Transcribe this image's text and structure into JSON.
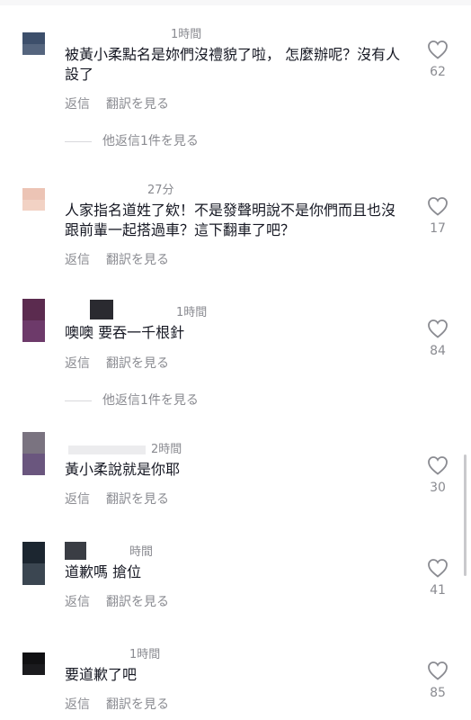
{
  "comments": [
    {
      "time": "1時間",
      "text": "被黃小柔點名是妳們沒禮貌了啦， 怎麼辦呢？沒有人設了",
      "reply": "返信",
      "translate": "翻訳を見る",
      "likes": "62",
      "more_replies": "他返信1件を見る",
      "avatar_colors": [
        "#3d4f6b",
        "#55657e"
      ]
    },
    {
      "time": "27分",
      "text": "人家指名道姓了欸！不是發聲明說不是你們而且也沒跟前輩一起搭過車？這下翻車了吧？",
      "reply": "返信",
      "translate": "翻訳を見る",
      "likes": "17",
      "avatar_colors": [
        "#ecc4b5",
        "#f2d2c4"
      ]
    },
    {
      "time": "1時間",
      "text": "噢噢 要吞一千根針",
      "reply": "返信",
      "translate": "翻訳を見る",
      "likes": "84",
      "more_replies": "他返信1件を見る",
      "avatar_colors": [
        "#5b2b4f",
        "#6d3a6a",
        "#4f2c52"
      ]
    },
    {
      "time": "2時間",
      "text": "黃小柔說就是你耶",
      "reply": "返信",
      "translate": "翻訳を見る",
      "likes": "30",
      "avatar_colors": [
        "#7a7380",
        "#6a567e",
        "#5b4b6d"
      ]
    },
    {
      "time": "時間",
      "text": "道歉嗎 搶位",
      "reply": "返信",
      "translate": "翻訳を見る",
      "likes": "41",
      "avatar_colors": [
        "#1c2630",
        "#2a3540",
        "#3b4651"
      ]
    },
    {
      "time": "1時間",
      "text": "要道歉了吧",
      "reply": "返信",
      "translate": "翻訳を見る",
      "likes": "85",
      "avatar_colors": [
        "#111113",
        "#1b1b1e"
      ]
    }
  ]
}
